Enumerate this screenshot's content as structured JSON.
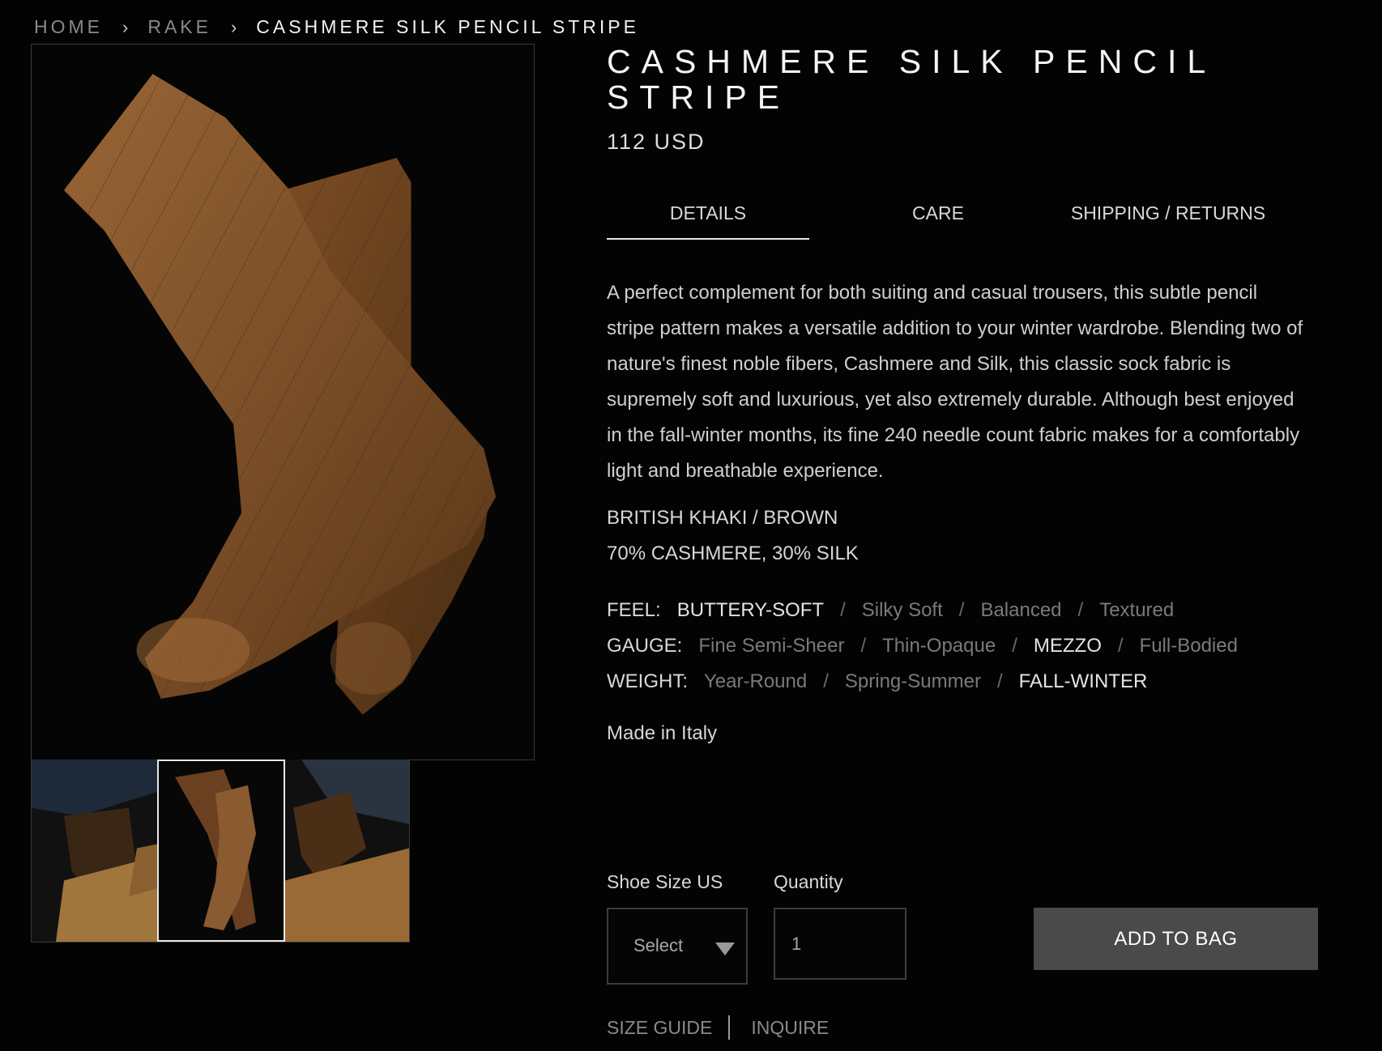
{
  "breadcrumb": {
    "home": "HOME",
    "category": "RAKE",
    "current": "CASHMERE SILK PENCIL STRIPE",
    "separator": "›"
  },
  "product": {
    "title": "CASHMERE SILK PENCIL STRIPE",
    "price": "112 USD",
    "description": "A perfect complement for both suiting and casual trousers, this subtle pencil stripe pattern makes a versatile addition to your winter wardrobe. Blending two of nature's finest noble fibers, Cashmere and Silk, this classic sock fabric is supremely soft and luxurious, yet also extremely durable.  Although best enjoyed in the fall-winter months, its fine 240 needle count fabric makes for a comfortably light and breathable experience.",
    "color": "BRITISH KHAKI / BROWN",
    "composition": "70% CASHMERE, 30% SILK",
    "made_in": "Made in Italy"
  },
  "tabs": [
    {
      "label": "DETAILS",
      "active": true
    },
    {
      "label": "CARE",
      "active": false
    },
    {
      "label": "SHIPPING / RETURNS",
      "active": false
    }
  ],
  "specs": {
    "feel": {
      "label": "FEEL:",
      "options": [
        "BUTTERY-SOFT",
        "Silky Soft",
        "Balanced",
        "Textured"
      ],
      "selected": 0
    },
    "gauge": {
      "label": "GAUGE:",
      "options": [
        "Fine Semi-Sheer",
        "Thin-Opaque",
        "MEZZO",
        "Full-Bodied"
      ],
      "selected": 2
    },
    "weight": {
      "label": "WEIGHT:",
      "options": [
        "Year-Round",
        "Spring-Summer",
        "FALL-WINTER"
      ],
      "selected": 2
    },
    "slash": "/"
  },
  "purchase": {
    "size_label": "Shoe Size US",
    "size_value": "Select",
    "quantity_label": "Quantity",
    "quantity_value": "1",
    "add_button": "ADD TO BAG",
    "size_guide": "SIZE GUIDE",
    "inquire": "INQUIRE"
  },
  "gallery": {
    "selected_thumb": 1,
    "icons": [
      "main-photo",
      "thumb-shoe-photo",
      "thumb-socks-photo",
      "thumb-loafer-photo"
    ]
  },
  "colors": {
    "background": "#030303",
    "sock_brown": "#8a5a30",
    "button_bg": "#4a4a4a"
  }
}
